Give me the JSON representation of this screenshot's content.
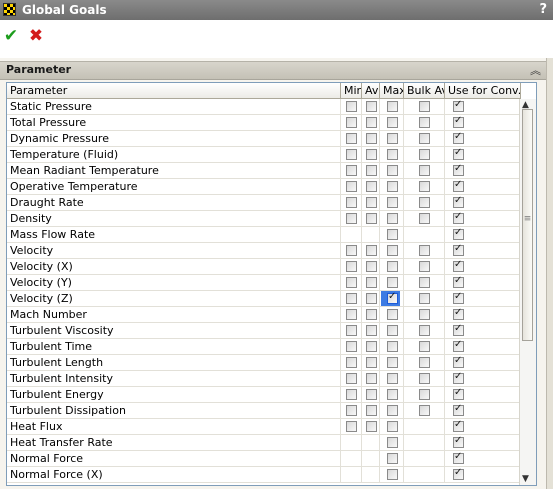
{
  "window": {
    "title": "Global Goals",
    "help": "?"
  },
  "toolbar": {
    "ok_icon": "check-icon",
    "cancel_icon": "close-icon"
  },
  "section": {
    "title": "Parameter",
    "collapse_icon": "double-chevron-up-icon"
  },
  "table": {
    "columns": [
      "Parameter",
      "Min",
      "Av",
      "Max",
      "Bulk Av",
      "Use for Conv."
    ],
    "rows": [
      {
        "name": "Static Pressure",
        "min": false,
        "av": false,
        "max": false,
        "bulk": false,
        "conv": true,
        "boxes": [
          1,
          1,
          1,
          1,
          1
        ]
      },
      {
        "name": "Total Pressure",
        "min": false,
        "av": false,
        "max": false,
        "bulk": false,
        "conv": true,
        "boxes": [
          1,
          1,
          1,
          1,
          1
        ]
      },
      {
        "name": "Dynamic Pressure",
        "min": false,
        "av": false,
        "max": false,
        "bulk": false,
        "conv": true,
        "boxes": [
          1,
          1,
          1,
          1,
          1
        ]
      },
      {
        "name": "Temperature (Fluid)",
        "min": false,
        "av": false,
        "max": false,
        "bulk": false,
        "conv": true,
        "boxes": [
          1,
          1,
          1,
          1,
          1
        ]
      },
      {
        "name": "Mean Radiant Temperature",
        "min": false,
        "av": false,
        "max": false,
        "bulk": false,
        "conv": true,
        "boxes": [
          1,
          1,
          1,
          1,
          1
        ]
      },
      {
        "name": "Operative Temperature",
        "min": false,
        "av": false,
        "max": false,
        "bulk": false,
        "conv": true,
        "boxes": [
          1,
          1,
          1,
          1,
          1
        ]
      },
      {
        "name": "Draught Rate",
        "min": false,
        "av": false,
        "max": false,
        "bulk": false,
        "conv": true,
        "boxes": [
          1,
          1,
          1,
          1,
          1
        ]
      },
      {
        "name": "Density",
        "min": false,
        "av": false,
        "max": false,
        "bulk": false,
        "conv": true,
        "boxes": [
          1,
          1,
          1,
          1,
          1
        ]
      },
      {
        "name": "Mass Flow Rate",
        "min": false,
        "av": false,
        "max": false,
        "bulk": false,
        "conv": true,
        "boxes": [
          0,
          0,
          1,
          0,
          1
        ]
      },
      {
        "name": "Velocity",
        "min": false,
        "av": false,
        "max": false,
        "bulk": false,
        "conv": true,
        "boxes": [
          1,
          1,
          1,
          1,
          1
        ]
      },
      {
        "name": "Velocity (X)",
        "min": false,
        "av": false,
        "max": false,
        "bulk": false,
        "conv": true,
        "boxes": [
          1,
          1,
          1,
          1,
          1
        ]
      },
      {
        "name": "Velocity (Y)",
        "min": false,
        "av": false,
        "max": false,
        "bulk": false,
        "conv": true,
        "boxes": [
          1,
          1,
          1,
          1,
          1
        ]
      },
      {
        "name": "Velocity (Z)",
        "min": false,
        "av": false,
        "max": true,
        "bulk": false,
        "conv": true,
        "boxes": [
          1,
          1,
          1,
          1,
          1
        ],
        "selected": true
      },
      {
        "name": "Mach Number",
        "min": false,
        "av": false,
        "max": false,
        "bulk": false,
        "conv": true,
        "boxes": [
          1,
          1,
          1,
          1,
          1
        ]
      },
      {
        "name": "Turbulent Viscosity",
        "min": false,
        "av": false,
        "max": false,
        "bulk": false,
        "conv": true,
        "boxes": [
          1,
          1,
          1,
          1,
          1
        ]
      },
      {
        "name": "Turbulent Time",
        "min": false,
        "av": false,
        "max": false,
        "bulk": false,
        "conv": true,
        "boxes": [
          1,
          1,
          1,
          1,
          1
        ]
      },
      {
        "name": "Turbulent Length",
        "min": false,
        "av": false,
        "max": false,
        "bulk": false,
        "conv": true,
        "boxes": [
          1,
          1,
          1,
          1,
          1
        ]
      },
      {
        "name": "Turbulent Intensity",
        "min": false,
        "av": false,
        "max": false,
        "bulk": false,
        "conv": true,
        "boxes": [
          1,
          1,
          1,
          1,
          1
        ]
      },
      {
        "name": "Turbulent Energy",
        "min": false,
        "av": false,
        "max": false,
        "bulk": false,
        "conv": true,
        "boxes": [
          1,
          1,
          1,
          1,
          1
        ]
      },
      {
        "name": "Turbulent Dissipation",
        "min": false,
        "av": false,
        "max": false,
        "bulk": false,
        "conv": true,
        "boxes": [
          1,
          1,
          1,
          1,
          1
        ]
      },
      {
        "name": "Heat Flux",
        "min": false,
        "av": false,
        "max": false,
        "bulk": false,
        "conv": true,
        "boxes": [
          1,
          1,
          1,
          0,
          1
        ]
      },
      {
        "name": "Heat Transfer Rate",
        "min": false,
        "av": false,
        "max": false,
        "bulk": false,
        "conv": true,
        "boxes": [
          0,
          0,
          1,
          0,
          1
        ]
      },
      {
        "name": "Normal Force",
        "min": false,
        "av": false,
        "max": false,
        "bulk": false,
        "conv": true,
        "boxes": [
          0,
          0,
          1,
          0,
          1
        ]
      },
      {
        "name": "Normal Force (X)",
        "min": false,
        "av": false,
        "max": false,
        "bulk": false,
        "conv": true,
        "boxes": [
          0,
          0,
          1,
          0,
          1
        ]
      }
    ]
  },
  "scrollbar": {
    "up_icon": "scroll-up-arrow-icon",
    "down_icon": "scroll-down-arrow-icon",
    "grip_icon": "grip-icon"
  }
}
